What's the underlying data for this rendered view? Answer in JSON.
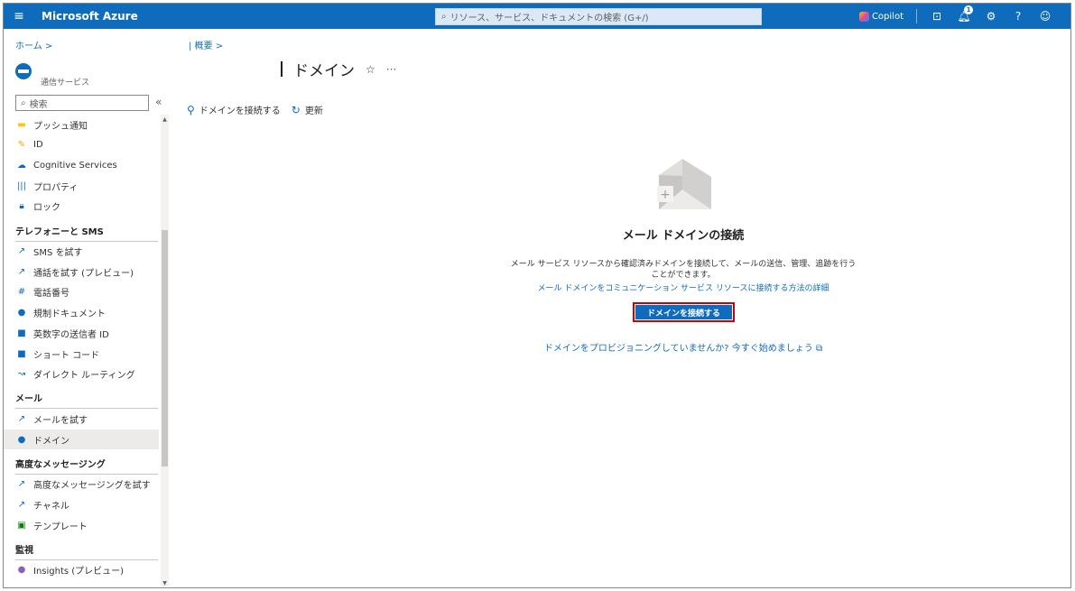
{
  "topbar": {
    "menu_icon": "hamburger-icon",
    "brand": "Microsoft Azure",
    "search_placeholder": "リソース、サービス、ドキュメントの検索 (G+/)",
    "copilot_label": "Copilot",
    "notification_count": "1"
  },
  "breadcrumb": {
    "home": "ホーム >",
    "overview": "| 概要 >"
  },
  "service": {
    "subtitle": "通信サービス"
  },
  "page": {
    "title": "ドメイン"
  },
  "sidebar": {
    "search_placeholder": "検索",
    "collapse": "«",
    "top_items": [
      {
        "label": "プッシュ通知",
        "icon": "push-notification-icon",
        "color": "#f2c811"
      },
      {
        "label": "ID",
        "icon": "identity-key-icon",
        "color": "#e8a800"
      },
      {
        "label": "Cognitive Services",
        "icon": "cloud-icon",
        "color": "#0f6cbd"
      },
      {
        "label": "プロパティ",
        "icon": "properties-icon",
        "color": "#0f6cbd"
      },
      {
        "label": "ロック",
        "icon": "lock-icon",
        "color": "#0f6cbd"
      }
    ],
    "sections": [
      {
        "title": "テレフォニーと SMS",
        "items": [
          {
            "label": "SMS を試す",
            "icon": "try-icon",
            "color": "#0f6cbd"
          },
          {
            "label": "通話を試す (プレビュー)",
            "icon": "try-icon",
            "color": "#0f6cbd"
          },
          {
            "label": "電話番号",
            "icon": "hash-icon",
            "color": "#0f6cbd"
          },
          {
            "label": "規制ドキュメント",
            "icon": "document-icon",
            "color": "#0f6cbd"
          },
          {
            "label": "英数字の送信者 ID",
            "icon": "sender-id-icon",
            "color": "#0f6cbd"
          },
          {
            "label": "ショート コード",
            "icon": "short-code-icon",
            "color": "#0f6cbd"
          },
          {
            "label": "ダイレクト ルーティング",
            "icon": "routing-icon",
            "color": "#0f6cbd"
          }
        ]
      },
      {
        "title": "メール",
        "items": [
          {
            "label": "メールを試す",
            "icon": "try-icon",
            "color": "#0f6cbd"
          },
          {
            "label": "ドメイン",
            "icon": "domain-icon",
            "color": "#0f6cbd",
            "selected": true
          }
        ]
      },
      {
        "title": "高度なメッセージング",
        "items": [
          {
            "label": "高度なメッセージングを試す",
            "icon": "try-icon",
            "color": "#0f6cbd"
          },
          {
            "label": "チャネル",
            "icon": "channel-icon",
            "color": "#0f6cbd"
          },
          {
            "label": "テンプレート",
            "icon": "template-icon",
            "color": "#107c10"
          }
        ]
      },
      {
        "title": "監視",
        "items": [
          {
            "label": "Insights (プレビュー)",
            "icon": "insights-icon",
            "color": "#8764b8"
          }
        ]
      }
    ]
  },
  "toolbar": {
    "connect_label": "ドメインを接続する",
    "refresh_label": "更新"
  },
  "empty_state": {
    "title": "メール ドメインの接続",
    "description": "メール サービス リソースから確認済みドメインを接続して、メールの送信、管理、追跡を行うことができます。",
    "learn_link": "メール ドメインをコミュニケーション サービス リソースに接続する方法の詳細",
    "cta_label": "ドメインを接続する",
    "provision_link": "ドメインをプロビジョニングしていませんか? 今すぐ始めましょう"
  },
  "colors": {
    "accent": "#0f6cbd",
    "highlight_border": "#d00000",
    "selected_bg": "#edebe9"
  }
}
